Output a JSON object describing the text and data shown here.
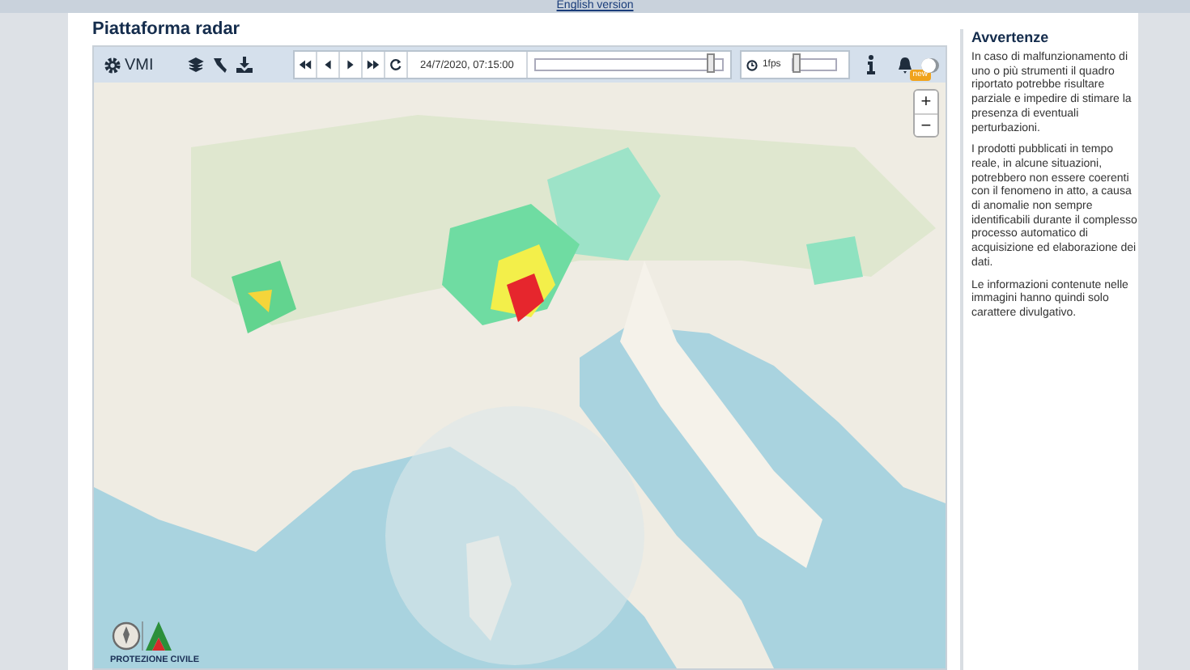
{
  "header": {
    "link": "English version"
  },
  "title": "Piattaforma radar",
  "toolbar": {
    "vmi_label": "VMI",
    "playback": [
      {
        "kind": "first"
      },
      {
        "kind": "prev"
      },
      {
        "kind": "play"
      },
      {
        "kind": "last"
      },
      {
        "kind": "refresh"
      }
    ],
    "time": "24/7/2020, 07:15:00",
    "time_slider": {
      "level": 0.94
    },
    "fps_label": "1fps",
    "speed_slider": {
      "level": 0.05
    },
    "badge": "new",
    "toggle": {
      "on": false
    }
  },
  "map": {
    "zoom_in": "+",
    "zoom_out": "−",
    "logo_text": "PROTEZIONE CIVILE"
  },
  "sidebar": {
    "title": "Avvertenze",
    "paragraphs": [
      "In caso di malfunzionamento di uno o più strumenti il quadro riportato potrebbe risultare parziale e impedire di stimare la presenza di eventuali perturbazioni.",
      "I prodotti pubblicati in tempo reale, in alcune situazioni, potrebbero non essere coerenti con il fenomeno in atto, a causa di anomalie non sempre identificabili durante il complesso processo automatico di  acquisizione ed elaborazione dei dati.",
      "Le informazioni contenute nelle immagini hanno quindi solo carattere divulgativo."
    ]
  }
}
